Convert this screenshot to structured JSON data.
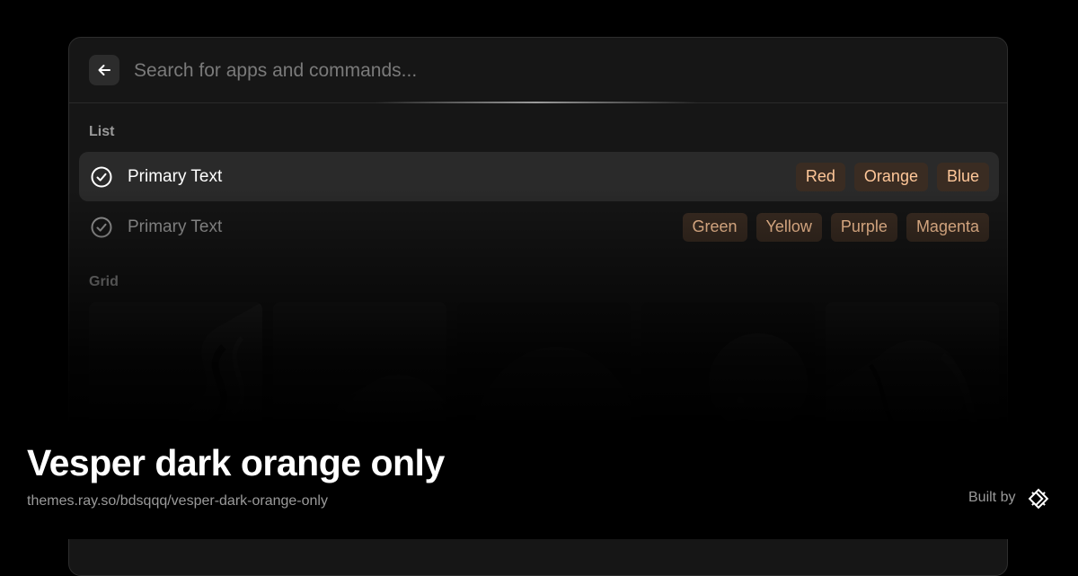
{
  "search": {
    "placeholder": "Search for apps and commands...",
    "back_icon": "arrow-left-icon"
  },
  "list": {
    "title": "List",
    "rows": [
      {
        "icon": "check-circle-icon",
        "text": "Primary Text",
        "selected": true,
        "tags": [
          "Red",
          "Orange",
          "Blue"
        ]
      },
      {
        "icon": "check-circle-icon",
        "text": "Primary Text",
        "selected": false,
        "tags": [
          "Green",
          "Yellow",
          "Purple",
          "Magenta"
        ]
      }
    ]
  },
  "grid": {
    "title": "Grid",
    "item_count": 5
  },
  "footer": {
    "theme_name": "Vesper dark orange only",
    "theme_url": "themes.ray.so/bdsqqq/vesper-dark-orange-only",
    "built_by_label": "Built by",
    "logo_icon": "raycast-logo-icon"
  },
  "colors": {
    "background": "#000000",
    "window": "#161616",
    "selection": "#2a2a2a",
    "tag_background": "#3a2c22",
    "tag_text": "#ffc799",
    "primary_text": "#ffffff",
    "secondary_text": "#9a9a9a"
  }
}
